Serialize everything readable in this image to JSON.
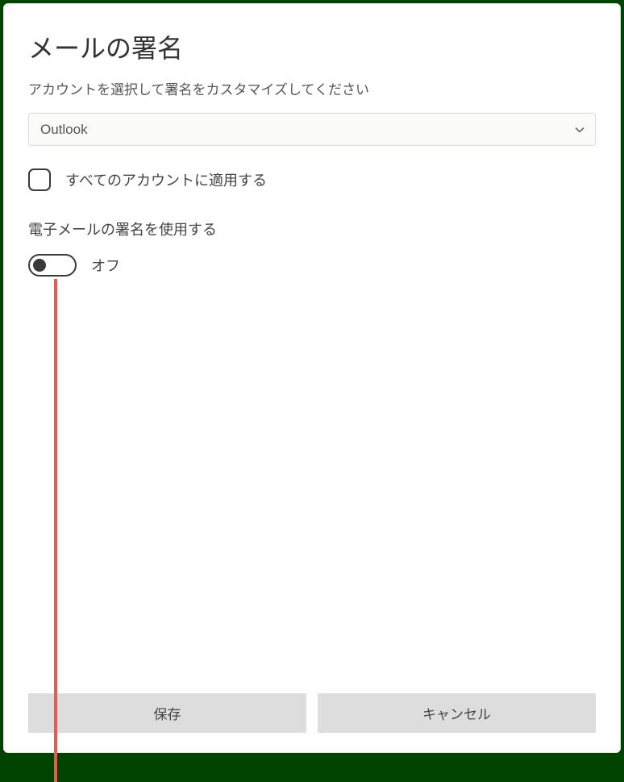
{
  "dialog": {
    "title": "メールの署名",
    "subtitle": "アカウントを選択して署名をカスタマイズしてください",
    "account_selected": "Outlook",
    "apply_all_label": "すべてのアカウントに適用する",
    "apply_all_checked": false,
    "use_signature_label": "電子メールの署名を使用する",
    "toggle_state": "オフ",
    "toggle_on": false,
    "buttons": {
      "save": "保存",
      "cancel": "キャンセル"
    }
  },
  "annotation": {
    "color": "#e85a4f"
  }
}
